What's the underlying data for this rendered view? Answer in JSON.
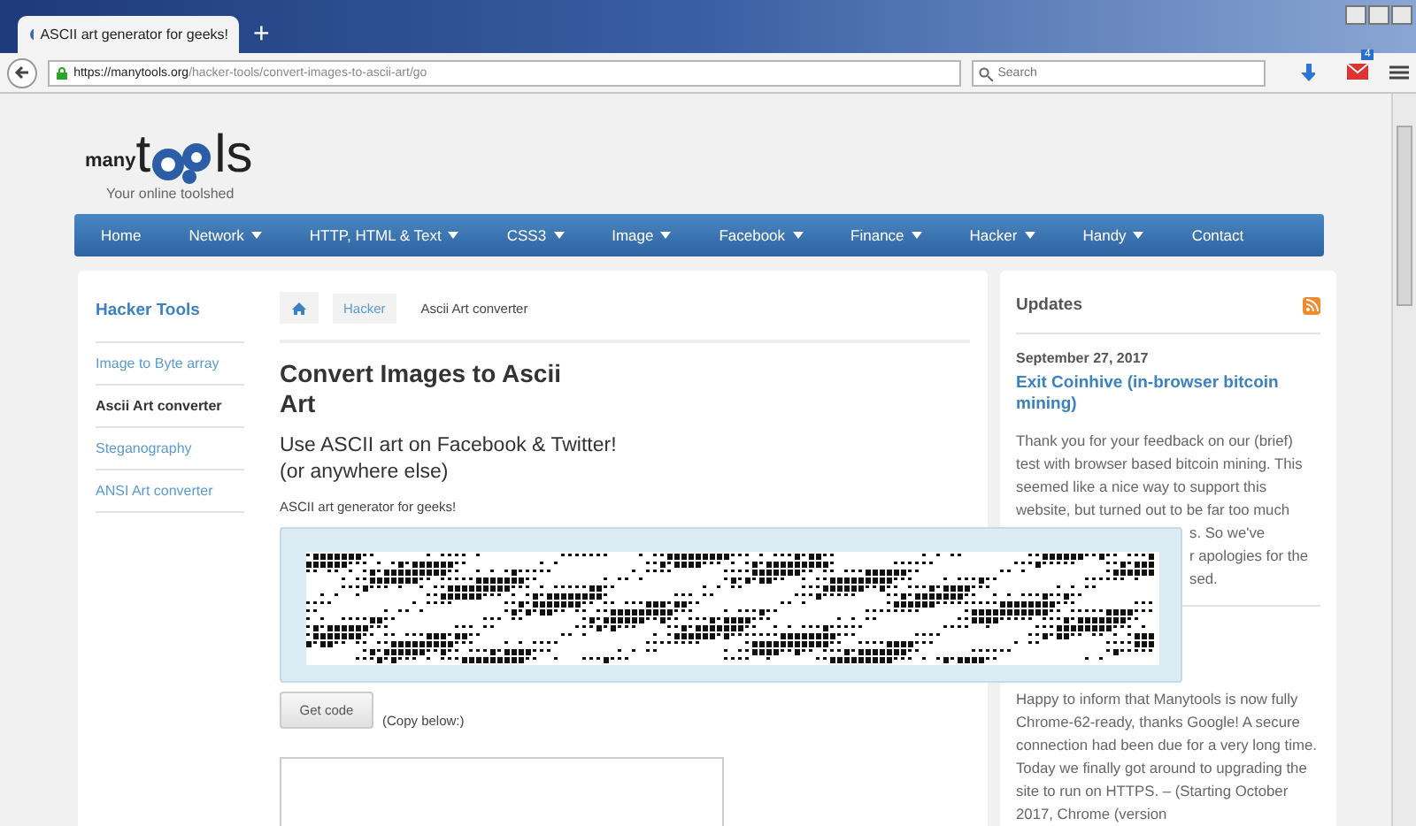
{
  "browser": {
    "tab_title": "ASCII art generator for geeks!",
    "new_tab": "+",
    "url_host": "https://manytools.org",
    "url_path": "/hacker-tools/convert-images-to-ascii-art/go",
    "search_placeholder": "Search",
    "mail_badge": "4"
  },
  "logo": {
    "word_small": "many",
    "word_big_left": "t",
    "word_big_right": "ls",
    "tagline": "Your online toolshed"
  },
  "nav": [
    {
      "label": "Home",
      "dropdown": false
    },
    {
      "label": "Network",
      "dropdown": true
    },
    {
      "label": "HTTP, HTML & Text",
      "dropdown": true
    },
    {
      "label": "CSS3",
      "dropdown": true
    },
    {
      "label": "Image",
      "dropdown": true
    },
    {
      "label": "Facebook",
      "dropdown": true
    },
    {
      "label": "Finance",
      "dropdown": true
    },
    {
      "label": "Hacker",
      "dropdown": true
    },
    {
      "label": "Handy",
      "dropdown": true
    },
    {
      "label": "Contact",
      "dropdown": false
    }
  ],
  "sidebar": {
    "title": "Hacker Tools",
    "items": [
      {
        "label": "Image to Byte array",
        "selected": false
      },
      {
        "label": "Ascii Art converter",
        "selected": true
      },
      {
        "label": "Steganography",
        "selected": false
      },
      {
        "label": "ANSI Art converter",
        "selected": false
      }
    ]
  },
  "breadcrumb": [
    "Hacker",
    "Ascii Art converter"
  ],
  "content": {
    "title": "Convert Images to Ascii Art",
    "subtitle_lines": [
      "Use ASCII art on Facebook & Twitter!",
      "(or anywhere else)"
    ],
    "intro": "ASCII art generator for geeks!",
    "button": "Get code",
    "button_note": "(Copy below:)"
  },
  "updates": {
    "title": "Updates",
    "posts": [
      {
        "date": "September 27, 2017",
        "title": "Exit Coinhive (in-browser bitcoin mining)",
        "lines": [
          {
            "text": "Thank you for your feedback on our (brief) test with browser based bitcoin mining. This seemed like a nice way to support this website, but turned out to be far too much",
            "covered": false
          },
          {
            "text": "s. So we've",
            "covered": true
          },
          {
            "text": "r apologies for the",
            "covered": true
          },
          {
            "text": "sed.",
            "covered": true
          }
        ]
      },
      {
        "lines": [
          {
            "text": "Happy to inform that Manytools is now fully Chrome-62-ready, thanks Google! A secure connection had been due for a very long time. Today we finally got around to upgrading the site to run on HTTPS. – (Starting October 2017, Chrome (version",
            "covered": false
          }
        ]
      }
    ]
  }
}
